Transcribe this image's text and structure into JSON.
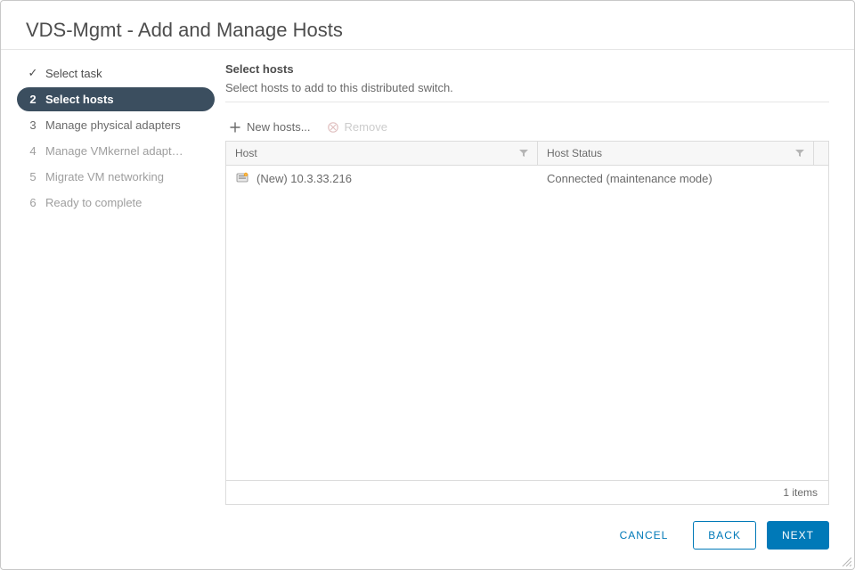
{
  "title": "VDS-Mgmt - Add and Manage Hosts",
  "wizard": {
    "steps": [
      {
        "num": "1",
        "label": "Select task",
        "state": "completed"
      },
      {
        "num": "2",
        "label": "Select hosts",
        "state": "active"
      },
      {
        "num": "3",
        "label": "Manage physical adapters",
        "state": "next-pending"
      },
      {
        "num": "4",
        "label": "Manage VMkernel adapt…",
        "state": "pending"
      },
      {
        "num": "5",
        "label": "Migrate VM networking",
        "state": "pending"
      },
      {
        "num": "6",
        "label": "Ready to complete",
        "state": "pending"
      }
    ]
  },
  "content": {
    "heading": "Select hosts",
    "description": "Select hosts to add to this distributed switch."
  },
  "toolbar": {
    "new_hosts_label": "New hosts...",
    "remove_label": "Remove"
  },
  "grid": {
    "columns": {
      "host": "Host",
      "status": "Host Status"
    },
    "rows": [
      {
        "host": "(New) 10.3.33.216",
        "status": "Connected (maintenance mode)"
      }
    ],
    "footer": "1 items"
  },
  "buttons": {
    "cancel": "CANCEL",
    "back": "BACK",
    "next": "NEXT"
  }
}
